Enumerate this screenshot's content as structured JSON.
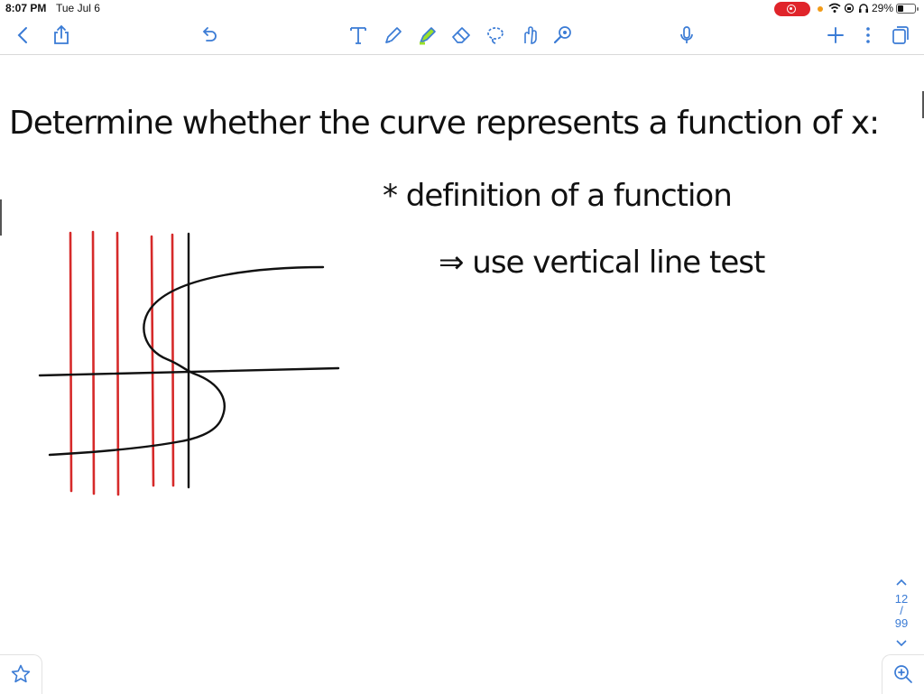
{
  "status_bar": {
    "time": "8:07 PM",
    "date": "Tue Jul 6",
    "battery_percent": "29%",
    "accent_red": "#e0242a"
  },
  "toolbar": {
    "left_icons": [
      "back-chevron-icon",
      "share-icon",
      "undo-icon"
    ],
    "tools": [
      "text-tool-icon",
      "pen-tool-icon",
      "highlighter-tool-icon",
      "eraser-tool-icon",
      "lasso-tool-icon",
      "shape-tool-icon",
      "laser-pointer-icon"
    ],
    "right_icons": [
      "microphone-icon",
      "add-page-icon",
      "more-options-icon",
      "pages-icon"
    ],
    "accent_blue": "#3a7bd5",
    "highlighter_color": "#9be02a"
  },
  "note": {
    "line1": "Determine whether the curve represents a function of x:",
    "line2": "* definition of a function",
    "line3": "⇒ use vertical line test",
    "ink_color": "#111111",
    "test_line_color": "#d62a2a"
  },
  "pager": {
    "current_page": "12",
    "separator": "/",
    "total_pages": "99"
  }
}
